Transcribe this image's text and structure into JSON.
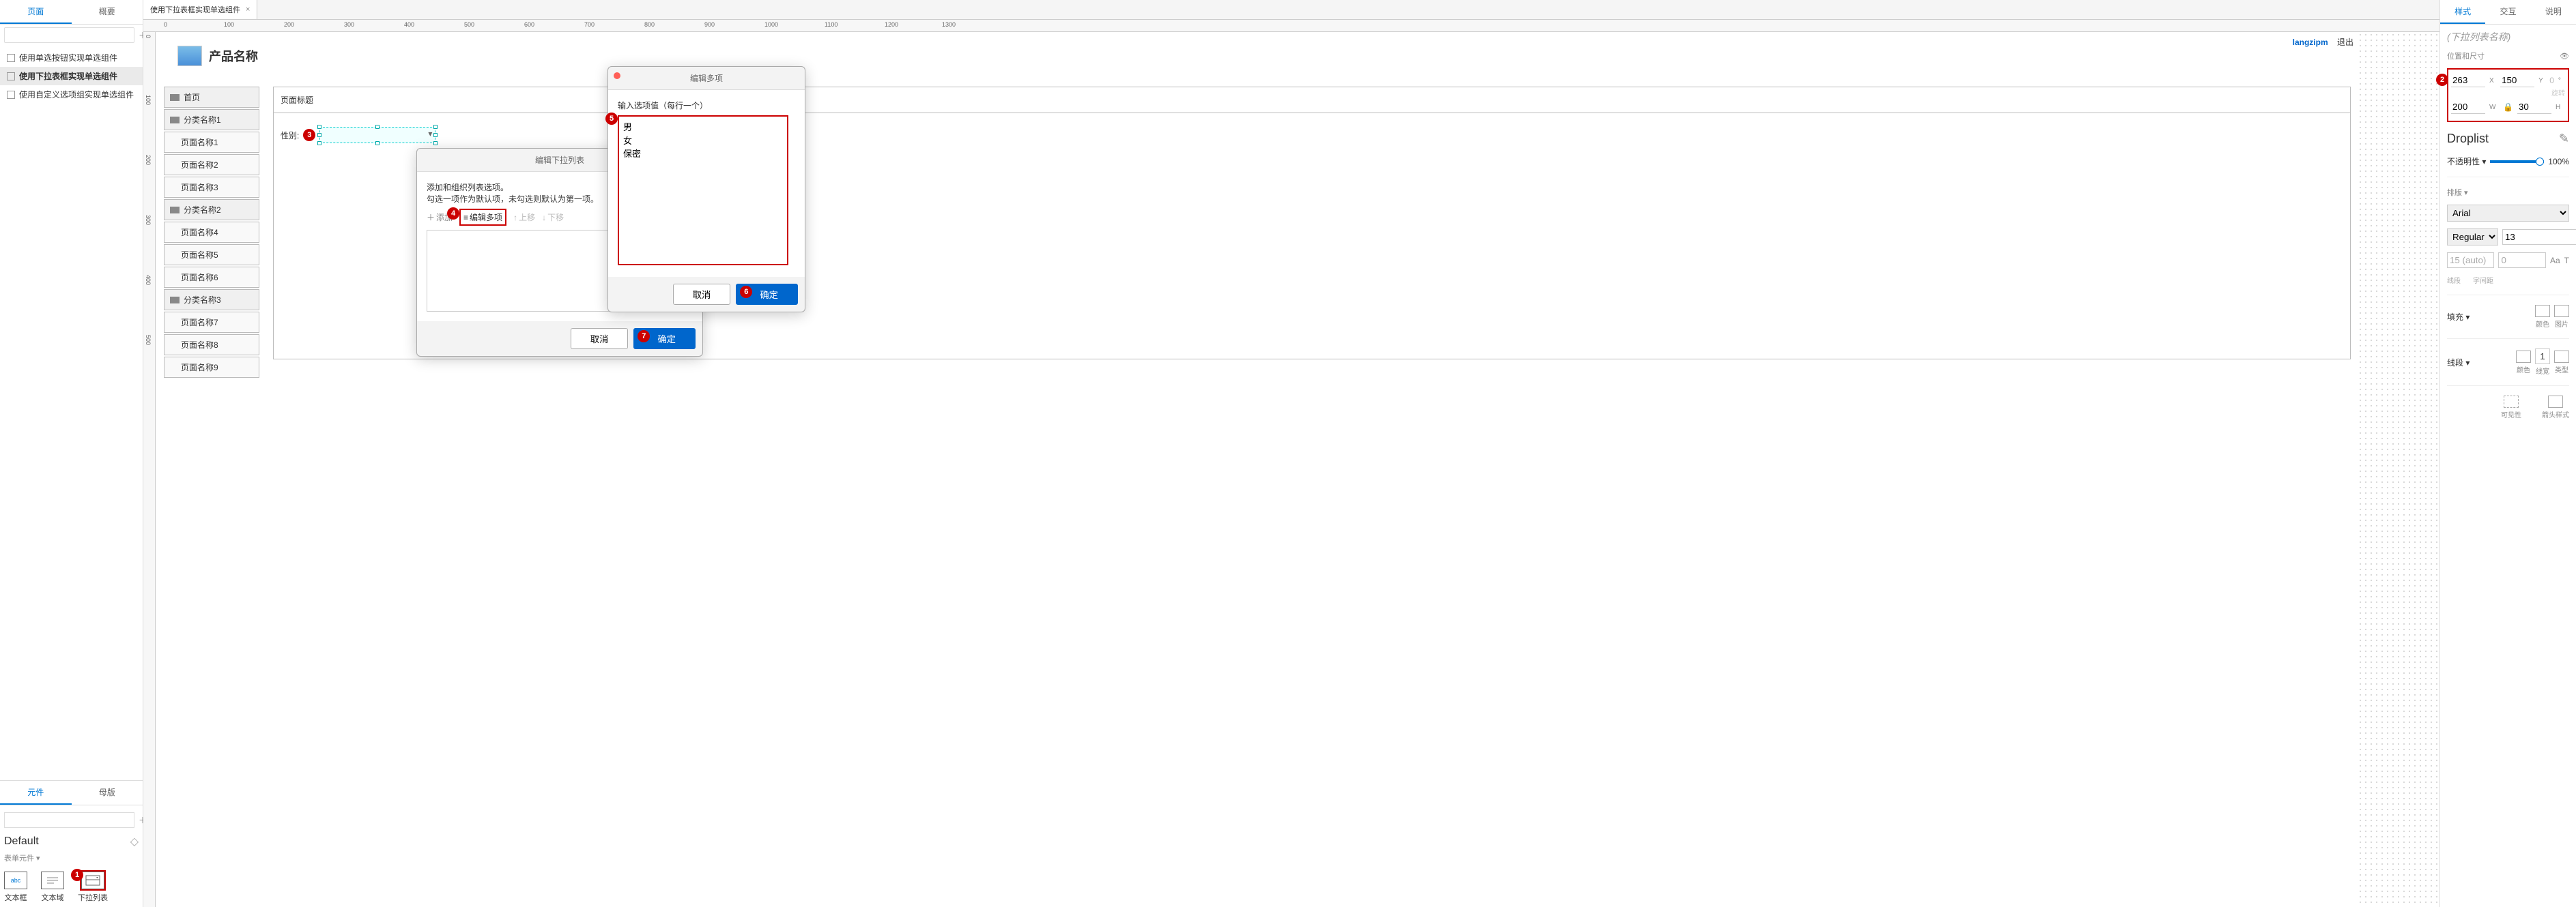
{
  "left": {
    "tabs": [
      "页面",
      "概要"
    ],
    "search_placeholder": "",
    "tree": [
      {
        "label": "使用单选按钮实现单选组件",
        "selected": false
      },
      {
        "label": "使用下拉表框实现单选组件",
        "selected": true
      },
      {
        "label": "使用自定义选项组实现单选组件",
        "selected": false
      }
    ],
    "lib_tabs": [
      "元件",
      "母版"
    ],
    "lib_default": "Default",
    "lib_sub": "表单元件 ▾",
    "widgets": [
      {
        "label": "文本框",
        "icon": "abc"
      },
      {
        "label": "文本域",
        "icon": "lines"
      },
      {
        "label": "下拉列表",
        "icon": "drop",
        "highlight": true
      }
    ]
  },
  "file_tab": "使用下拉表框实现单选组件",
  "ruler_marks": [
    "0",
    "100",
    "200",
    "300",
    "400",
    "500",
    "600",
    "700",
    "800",
    "900",
    "1000",
    "1100",
    "1200",
    "1300"
  ],
  "ruler_v": [
    "0",
    "100",
    "200",
    "300",
    "400",
    "500"
  ],
  "topbar": {
    "user": "langzipm",
    "logout": "退出"
  },
  "product_title": "产品名称",
  "sitemap": [
    {
      "label": "首页",
      "type": "head"
    },
    {
      "label": "分类名称1",
      "type": "head"
    },
    {
      "label": "页面名称1",
      "type": "sub"
    },
    {
      "label": "页面名称2",
      "type": "sub"
    },
    {
      "label": "页面名称3",
      "type": "sub"
    },
    {
      "label": "分类名称2",
      "type": "head"
    },
    {
      "label": "页面名称4",
      "type": "sub"
    },
    {
      "label": "页面名称5",
      "type": "sub"
    },
    {
      "label": "页面名称6",
      "type": "sub"
    },
    {
      "label": "分类名称3",
      "type": "head"
    },
    {
      "label": "页面名称7",
      "type": "sub"
    },
    {
      "label": "页面名称8",
      "type": "sub"
    },
    {
      "label": "页面名称9",
      "type": "sub"
    }
  ],
  "page_title_label": "页面标题",
  "field_label": "性别:",
  "dialog1": {
    "title": "编辑下拉列表",
    "desc1": "添加和组织列表选项。",
    "desc2": "勾选一项作为默认项，未勾选则默认为第一项。",
    "tools": {
      "add": "添加",
      "edit": "编辑多项",
      "up": "上移",
      "down": "下移"
    },
    "cancel": "取消",
    "ok": "确定"
  },
  "dialog2": {
    "title": "编辑多项",
    "prompt": "输入选项值（每行一个）",
    "value": "男\n女\n保密",
    "cancel": "取消",
    "ok": "确定"
  },
  "right": {
    "tabs": [
      "样式",
      "交互",
      "说明"
    ],
    "name_placeholder": "(下拉列表名称)",
    "pos_label": "位置和尺寸",
    "x": "263",
    "y": "150",
    "w": "200",
    "h": "30",
    "rot": "0",
    "rot_unit": "°",
    "rot_hint": "旋转",
    "type": "Droplist",
    "opacity_label": "不透明性 ▾",
    "opacity": "100%",
    "layout_label": "排版 ▾",
    "font": "Arial",
    "weight": "Regular",
    "size": "13",
    "line_h": "15 (auto)",
    "line_h_lab": "线段",
    "letter": "0",
    "letter_lab": "字间距",
    "fill_label": "填充 ▾",
    "fill_color": "颜色",
    "fill_img": "图片",
    "stroke_label": "线段 ▾",
    "stroke_color": "颜色",
    "stroke_w": "1",
    "stroke_w_lab": "线宽",
    "stroke_type": "类型",
    "vis_label": "可见性",
    "arrow_label": "箭头样式",
    "aa": "Aa",
    "t": "T"
  },
  "badges": {
    "1": "1",
    "2": "2",
    "3": "3",
    "4": "4",
    "5": "5",
    "6": "6",
    "7": "7"
  }
}
